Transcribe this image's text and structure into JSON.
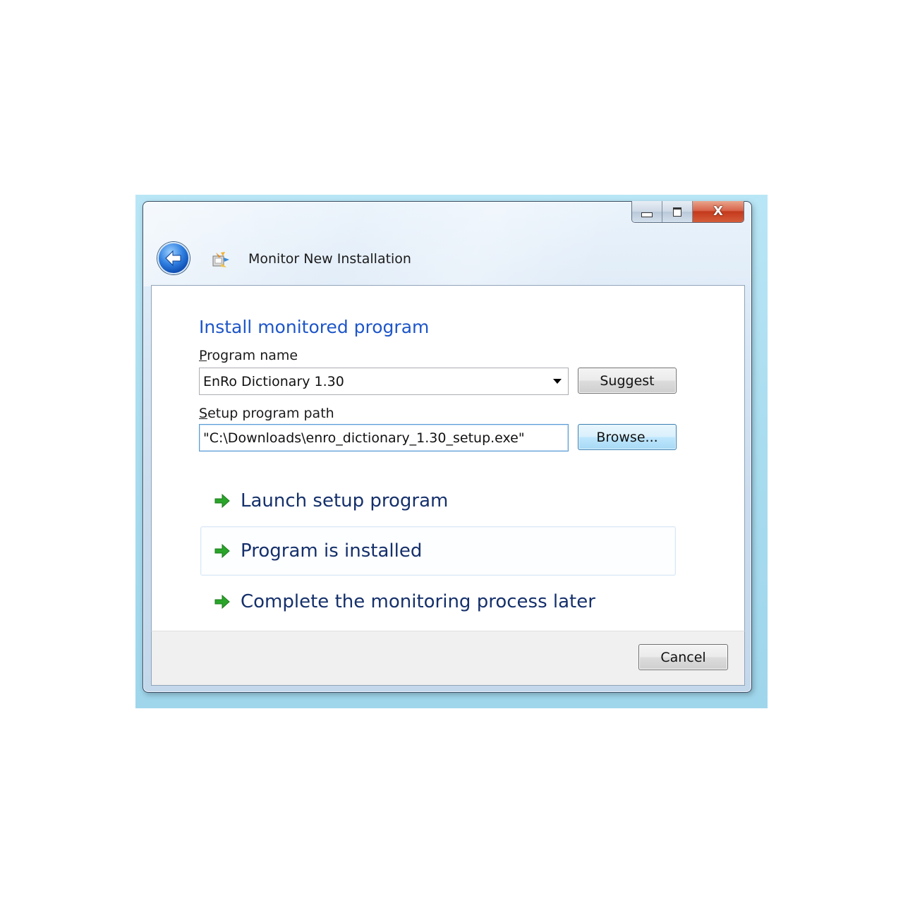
{
  "window": {
    "title": "Monitor New Installation",
    "close_glyph": "X",
    "caption_buttons": [
      "minimize-icon",
      "maximize-icon",
      "close-icon"
    ]
  },
  "navigation": {
    "back_icon": "back-arrow-icon",
    "app_icon": "install-monitor-icon"
  },
  "page": {
    "heading": "Install monitored program",
    "program_name": {
      "label_accel": "P",
      "label_rest": "rogram name",
      "value": "EnRo Dictionary 1.30"
    },
    "setup_path": {
      "label_accel": "S",
      "label_rest": "etup program path",
      "value": "\"C:\\Downloads\\enro_dictionary_1.30_setup.exe\""
    },
    "suggest_label": "Suggest",
    "browse_label": "Browse...",
    "command_links": [
      {
        "label": "Launch setup program",
        "icon": "green-arrow-icon"
      },
      {
        "label": "Program is installed",
        "icon": "green-arrow-icon"
      },
      {
        "label": "Complete the monitoring process later",
        "icon": "green-arrow-icon"
      }
    ]
  },
  "footer": {
    "cancel_label": "Cancel"
  },
  "colors": {
    "heading": "#1e56c8",
    "command_link_text": "#15306b",
    "arrow_green": "#2aa52a",
    "backdrop": "#a8dcef"
  }
}
